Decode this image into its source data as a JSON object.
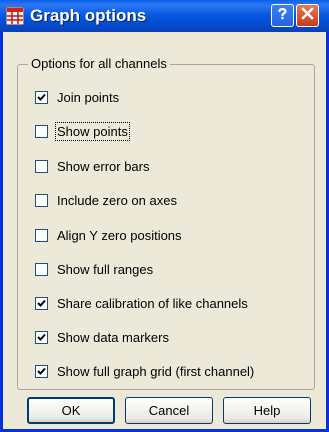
{
  "window": {
    "title": "Graph options"
  },
  "group": {
    "legend": "Options for all channels"
  },
  "options": [
    {
      "label": "Join points",
      "checked": true
    },
    {
      "label": "Show points",
      "checked": false,
      "focused": true
    },
    {
      "label": "Show error bars",
      "checked": false
    },
    {
      "label": "Include zero on axes",
      "checked": false
    },
    {
      "label": "Align Y zero positions",
      "checked": false
    },
    {
      "label": "Show full ranges",
      "checked": false
    },
    {
      "label": "Share calibration of like channels",
      "checked": true
    },
    {
      "label": "Show data markers",
      "checked": true
    },
    {
      "label": "Show full graph grid (first channel)",
      "checked": true
    }
  ],
  "buttons": {
    "ok": "OK",
    "cancel": "Cancel",
    "help": "Help"
  },
  "icons": {
    "app": "chart-grid-icon",
    "help": "question-icon",
    "close": "close-x-icon"
  },
  "colors": {
    "titlebar": "#0556df",
    "close_button": "#c43c1b",
    "dialog_background": "#ece9d8"
  }
}
